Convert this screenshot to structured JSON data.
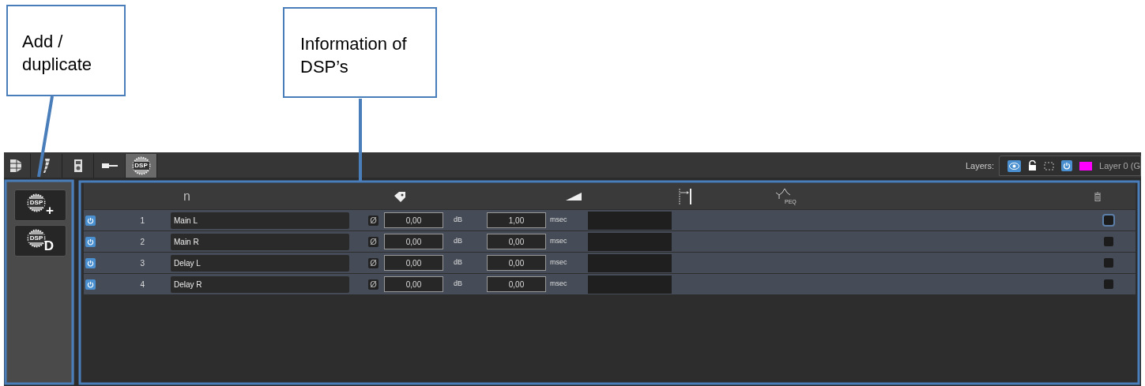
{
  "callouts": [
    {
      "text": "Add / duplicate"
    },
    {
      "text": "Information of DSP’s"
    }
  ],
  "toolbar": {
    "tabs": [
      {
        "kind": "array",
        "selected": false
      },
      {
        "kind": "line",
        "selected": false
      },
      {
        "kind": "cabinet",
        "selected": false
      },
      {
        "kind": "cable",
        "selected": false
      },
      {
        "kind": "dsp",
        "badge": "DSP",
        "selected": true
      }
    ]
  },
  "layers": {
    "label": "Layers:",
    "visible": true,
    "locked": false,
    "powered": true,
    "color": "#ff00ff",
    "name": "Layer 0 (G"
  },
  "side_buttons": [
    {
      "badge": "DSP",
      "symbol": "+"
    },
    {
      "badge": "DSP",
      "symbol": "D"
    }
  ],
  "table": {
    "columns": [
      {
        "kind": "n",
        "label": "n"
      },
      {
        "kind": "name"
      },
      {
        "kind": "gain"
      },
      {
        "kind": "delay"
      },
      {
        "kind": "peq",
        "label": "PEQ"
      },
      {
        "kind": "delete"
      }
    ],
    "rows": [
      {
        "on": true,
        "n": "1",
        "name": "Main L",
        "phase": "Ø",
        "gain": "0,00",
        "gain_unit": "dB",
        "delay": "1,00",
        "delay_unit": "msec",
        "checked": false,
        "focused": true
      },
      {
        "on": true,
        "n": "2",
        "name": "Main R",
        "phase": "Ø",
        "gain": "0,00",
        "gain_unit": "dB",
        "delay": "0,00",
        "delay_unit": "msec",
        "checked": false,
        "focused": false
      },
      {
        "on": true,
        "n": "3",
        "name": "Delay L",
        "phase": "Ø",
        "gain": "0,00",
        "gain_unit": "dB",
        "delay": "0,00",
        "delay_unit": "msec",
        "checked": false,
        "focused": false
      },
      {
        "on": true,
        "n": "4",
        "name": "Delay R",
        "phase": "Ø",
        "gain": "0,00",
        "gain_unit": "dB",
        "delay": "0,00",
        "delay_unit": "msec",
        "checked": false,
        "focused": false
      }
    ]
  }
}
